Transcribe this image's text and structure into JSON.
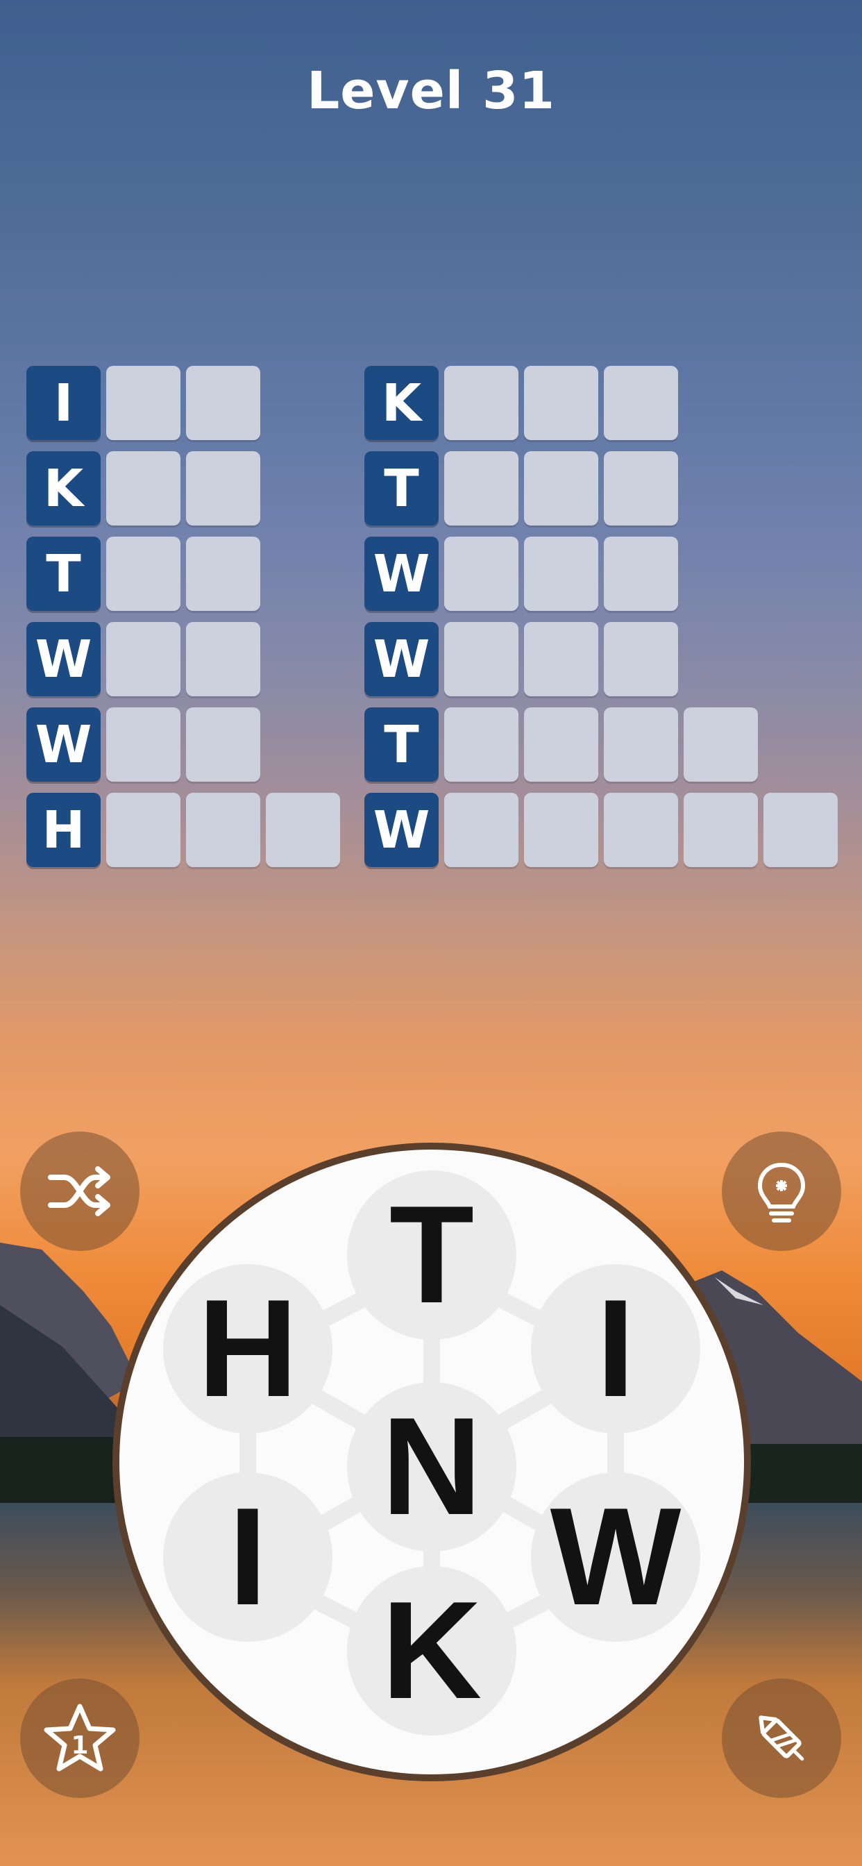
{
  "header": {
    "title": "Level 31"
  },
  "grid": {
    "left_column": [
      {
        "first_letter": "I",
        "length": 3
      },
      {
        "first_letter": "K",
        "length": 3
      },
      {
        "first_letter": "T",
        "length": 3
      },
      {
        "first_letter": "W",
        "length": 3
      },
      {
        "first_letter": "W",
        "length": 3
      },
      {
        "first_letter": "H",
        "length": 4
      }
    ],
    "right_column": [
      {
        "first_letter": "K",
        "length": 4
      },
      {
        "first_letter": "T",
        "length": 4
      },
      {
        "first_letter": "W",
        "length": 4
      },
      {
        "first_letter": "W",
        "length": 4
      },
      {
        "first_letter": "T",
        "length": 5
      },
      {
        "first_letter": "W",
        "length": 6
      }
    ]
  },
  "wheel": {
    "letters": [
      "T",
      "H",
      "I",
      "N",
      "I",
      "W",
      "K"
    ]
  },
  "controls": {
    "shuffle_icon": "shuffle-icon",
    "hint_icon": "lightbulb-icon",
    "bonus_icon": "star-icon",
    "bonus_count": "1",
    "rocket_icon": "firework-rocket-icon"
  },
  "colors": {
    "revealed_tile": "#1c4a83",
    "empty_tile": "#cdd1de",
    "wheel_rim": "#5a3f2c",
    "control_button": "#7a5032"
  }
}
